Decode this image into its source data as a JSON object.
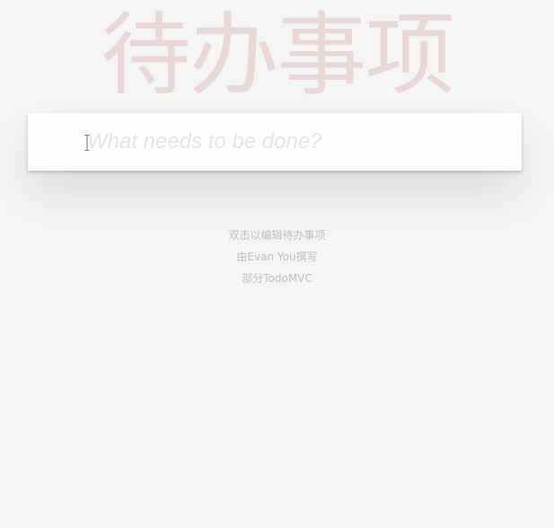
{
  "header": {
    "title": "待办事项"
  },
  "new_todo": {
    "placeholder": "What needs to be done?",
    "value": ""
  },
  "footer_info": {
    "hint": "双击以编辑待办事项",
    "written_by_prefix": "由",
    "author": "Evan You",
    "written_by_suffix": "撰写",
    "part_of_prefix": "部分",
    "project": "TodoMVC"
  },
  "colors": {
    "background": "#f5f5f5",
    "title": "rgba(175, 47, 47, 0.15)",
    "panel": "#fefefe",
    "placeholder": "#e6e6e6",
    "info_text": "#bfbfbf"
  },
  "icons": {
    "cursor": "text-cursor-icon"
  }
}
